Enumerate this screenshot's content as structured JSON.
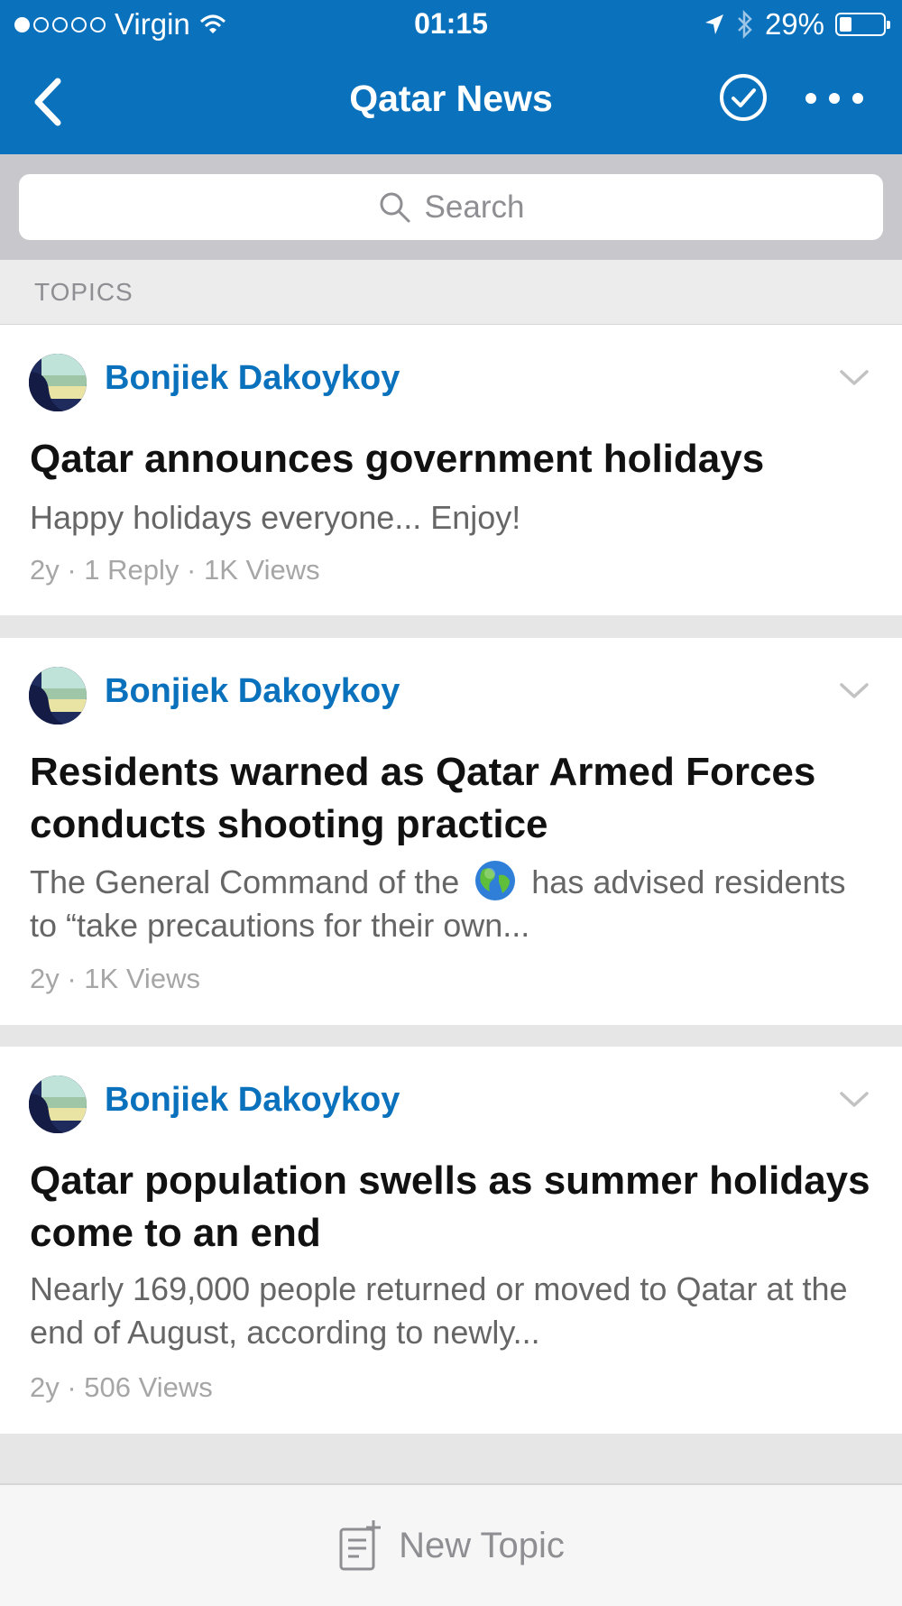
{
  "status_bar": {
    "carrier": "Virgin",
    "time": "01:15",
    "battery": "29%",
    "battery_level": 0.29
  },
  "nav": {
    "title": "Qatar News"
  },
  "search": {
    "placeholder": "Search"
  },
  "topics_label": "TOPICS",
  "topics": [
    {
      "author": "Bonjiek Dakoykoy",
      "title": "Qatar announces government holidays",
      "excerpt": "Happy holidays everyone... Enjoy!",
      "meta": "2y · 1 Reply · 1K Views"
    },
    {
      "author": "Bonjiek Dakoykoy",
      "title": "Residents warned as Qatar Armed Forces conducts shooting practice",
      "excerpt_before": "The General Command of the",
      "excerpt_after": "has advised residents to “take precautions for their own...",
      "meta": "2y · 1K Views"
    },
    {
      "author": "Bonjiek Dakoykoy",
      "title": "Qatar population swells as summer holidays come to an end",
      "excerpt": "Nearly 169,000 people returned or moved to Qatar at the end of August, according to newly...",
      "meta": "2y · 506 Views"
    }
  ],
  "bottom_bar": {
    "new_topic_label": "New Topic"
  }
}
